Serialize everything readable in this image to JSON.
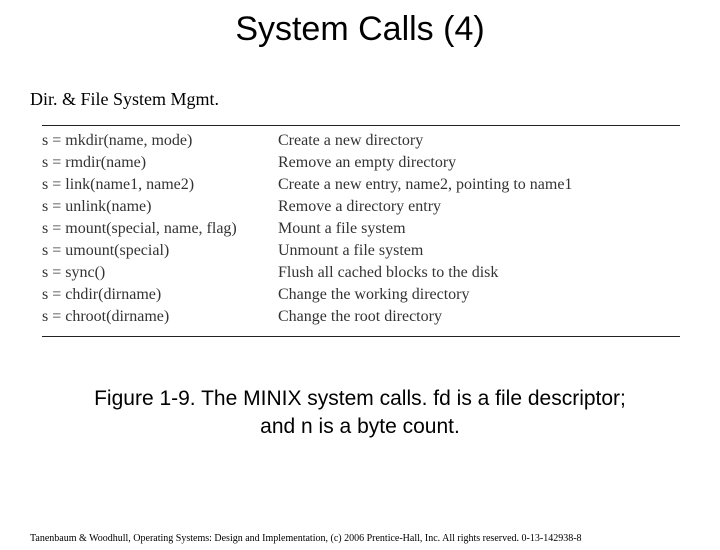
{
  "title": "System Calls (4)",
  "section": "Dir. & File System Mgmt.",
  "rows": [
    {
      "call": "s = mkdir(name, mode)",
      "desc": "Create a new directory"
    },
    {
      "call": "s = rmdir(name)",
      "desc": "Remove an empty directory"
    },
    {
      "call": "s = link(name1, name2)",
      "desc": "Create a new entry, name2, pointing to name1"
    },
    {
      "call": "s = unlink(name)",
      "desc": "Remove a directory entry"
    },
    {
      "call": "s = mount(special, name, flag)",
      "desc": "Mount a file system"
    },
    {
      "call": "s = umount(special)",
      "desc": "Unmount a file system"
    },
    {
      "call": "s = sync()",
      "desc": "Flush all cached blocks to the disk"
    },
    {
      "call": "s = chdir(dirname)",
      "desc": "Change the working directory"
    },
    {
      "call": "s = chroot(dirname)",
      "desc": "Change the root directory"
    }
  ],
  "caption_line1": "Figure 1-9. The MINIX system calls. fd is a file descriptor;",
  "caption_line2": "and n is a byte count.",
  "footer": "Tanenbaum & Woodhull, Operating Systems: Design and Implementation, (c) 2006 Prentice-Hall, Inc. All rights reserved. 0-13-142938-8"
}
